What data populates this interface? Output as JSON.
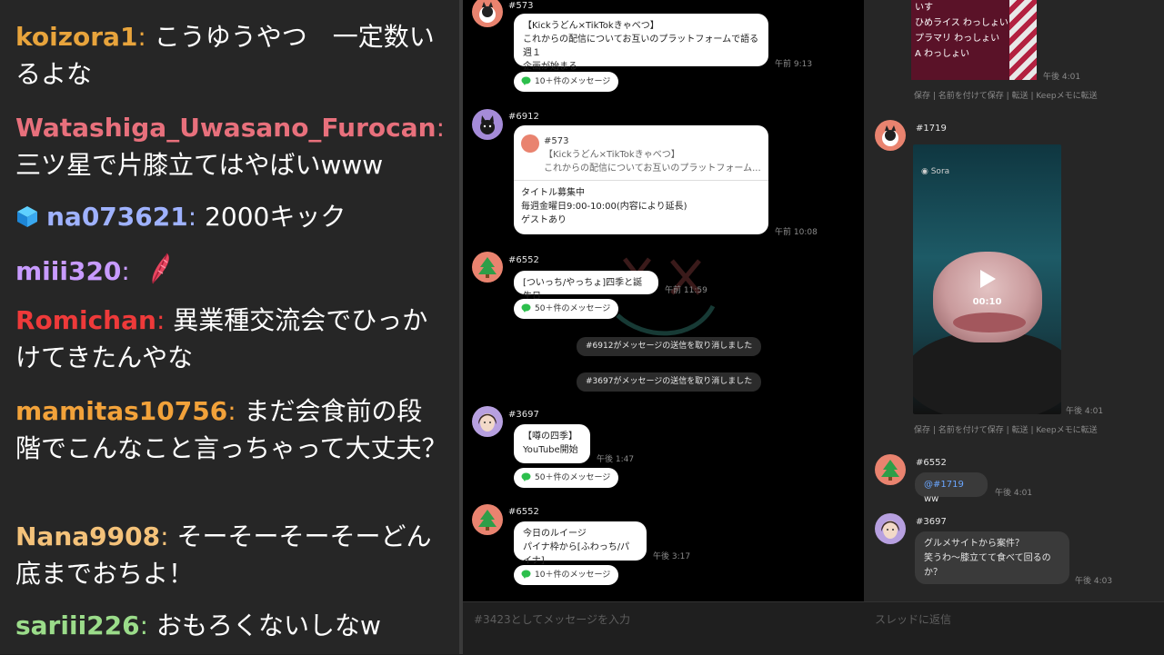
{
  "live_chat": [
    {
      "user": "koizora1",
      "color": "#e8a43c",
      "text": "こうゆうやつ　一定数いるよな"
    },
    {
      "user": "Watashiga_Uwasano_Furocan",
      "color": "#e8707c",
      "text": "三ツ星で片膝立てはやばいwww"
    },
    {
      "user": "na073621",
      "color": "#9fb2ff",
      "text": "2000キック",
      "badge": "cube-icon"
    },
    {
      "user": "miii320",
      "color": "#c89bff",
      "text": "",
      "emote": "feather-emote"
    },
    {
      "user": "Romichan",
      "color": "#ee3a3a",
      "text": "異業種交流会でひっかけてきたんやな"
    },
    {
      "user": "mamitas10756",
      "color": "#f2a23a",
      "text": "まだ会食前の段階でこんなこと言っちゃって大丈夫？"
    },
    {
      "user": "Nana9908",
      "color": "#f4c27a",
      "text": "そーそーそーそーどん底までおちよ！"
    },
    {
      "user": "sariii226",
      "color": "#9bdc8a",
      "text": "おもろくないしなw"
    }
  ],
  "main": {
    "input_placeholder": "#3423としてメッセージを入力",
    "messages": [
      {
        "id": "#573",
        "lines": [
          "【Kickうどん×TikTokきゃべつ】",
          "これからの配信についてお互いのプラットフォームで語る週１",
          "企画が始まる"
        ],
        "time": "午前 9:13",
        "more": "10＋件のメッセージ"
      },
      {
        "id": "#6912",
        "quote_id": "#573",
        "quote_lines": [
          "【Kickうどん×TikTokきゃべつ】",
          "これからの配信についてお互いのプラットフォーム..."
        ],
        "lines": [
          "タイトル募集中",
          "毎週金曜日9:00-10:00(内容により延長)",
          "ゲストあり"
        ],
        "time": "午前 10:08"
      },
      {
        "id": "#6552",
        "lines": [
          "[ついっち/やっちょ]四季と誕生日"
        ],
        "time": "午前 11:59",
        "more": "50＋件のメッセージ"
      },
      {
        "id": "#3697",
        "lines": [
          "【噂の四季】",
          "YouTube開始"
        ],
        "time": "午後 1:47",
        "more": "50＋件のメッセージ"
      },
      {
        "id": "#6552",
        "lines": [
          "今日のルイージ",
          "パイナ枠から[ふわっち/パイナ]"
        ],
        "time": "午後 3:17",
        "more": "10＋件のメッセージ"
      }
    ],
    "system_messages": [
      "#6912がメッセージの送信を取り消しました",
      "#3697がメッセージの送信を取り消しました"
    ]
  },
  "thread": {
    "reply_placeholder": "スレッドに返信",
    "top_image_lines": [
      "いす",
      "ひめライス わっしょい",
      "プラマリ わっしょい",
      "A わっしょい"
    ],
    "top_time": "午後 4:01",
    "actions": [
      "保存",
      "名前を付けて保存",
      "転送",
      "Keepメモに転送"
    ],
    "video": {
      "user": "#1719",
      "watermark": "Sora",
      "duration": "00:10",
      "time": "午後 4:01"
    },
    "msg1": {
      "user": "#6552",
      "mention": "@#1719",
      "text": "ww",
      "time": "午後 4:01"
    },
    "msg2": {
      "user": "#3697",
      "lines": [
        "グルメサイトから案件？",
        "笑うわ～膝立てて食べて回るの",
        "か？"
      ],
      "time": "午後 4:03"
    }
  }
}
